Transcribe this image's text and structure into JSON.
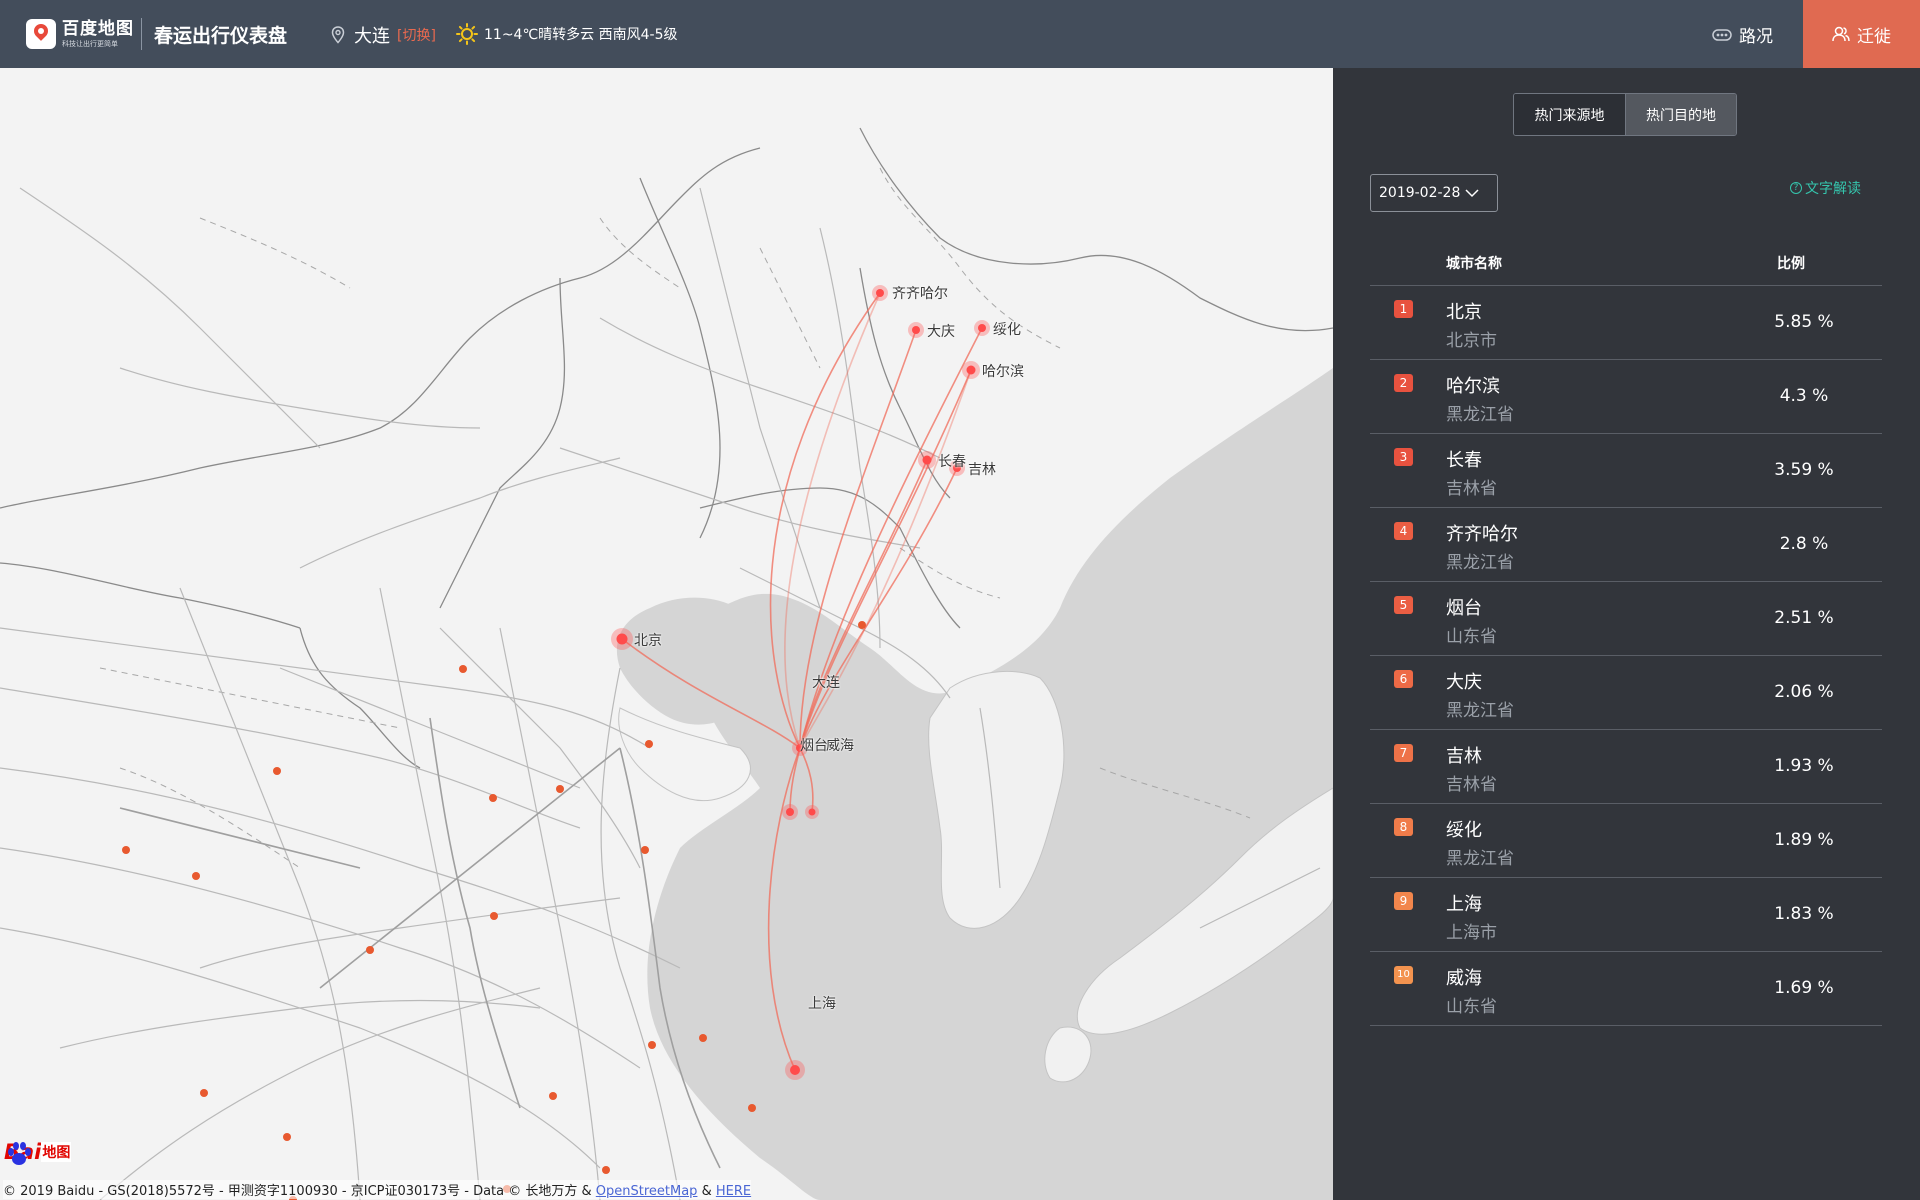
{
  "header": {
    "logo_name": "百度地图",
    "logo_sub": "科技让出行更简单",
    "title": "春运出行仪表盘",
    "city": "大连",
    "city_switch": "[切换]",
    "weather": "11~4℃晴转多云 西南风4-5级",
    "traffic_label": "路况",
    "migrate_label": "迁徙",
    "icons": [
      "pin-icon",
      "sun-icon",
      "traffic-icon",
      "user-icon"
    ],
    "accent_color": "#e06a51"
  },
  "map": {
    "origin": "大连",
    "cities": [
      {
        "name": "齐齐哈尔"
      },
      {
        "name": "大庆"
      },
      {
        "name": "绥化"
      },
      {
        "name": "哈尔滨"
      },
      {
        "name": "长春"
      },
      {
        "name": "吉林"
      },
      {
        "name": "北京"
      },
      {
        "name": "大连"
      },
      {
        "name": "烟台"
      },
      {
        "name": "威海"
      },
      {
        "name": "上海"
      }
    ],
    "flow_color": "#f06b5a",
    "baidu_bai": "Bai",
    "baidu_map": "地图",
    "copyright_text": "© 2019 Baidu - GS(2018)5572号 - 甲测资字1100930 - 京ICP证030173号 - Data © 长地万方 & ",
    "copyright_link1": "OpenStreetMap",
    "copyright_amp": " & ",
    "copyright_link2": "HERE"
  },
  "panel": {
    "tabs": [
      "热门来源地",
      "热门目的地"
    ],
    "active_tab": "热门目的地",
    "date": "2019-02-28",
    "explain_link": "文字解读",
    "col_city": "城市名称",
    "col_ratio": "比例",
    "rows": [
      {
        "rank": "1",
        "city": "北京",
        "province": "北京市",
        "ratio": "5.85 %",
        "badge_color": "#e8523f"
      },
      {
        "rank": "2",
        "city": "哈尔滨",
        "province": "黑龙江省",
        "ratio": "4.3 %",
        "badge_color": "#e8523f"
      },
      {
        "rank": "3",
        "city": "长春",
        "province": "吉林省",
        "ratio": "3.59 %",
        "badge_color": "#e8523f"
      },
      {
        "rank": "4",
        "city": "齐齐哈尔",
        "province": "黑龙江省",
        "ratio": "2.8 %",
        "badge_color": "#eb5e43"
      },
      {
        "rank": "5",
        "city": "烟台",
        "province": "山东省",
        "ratio": "2.51 %",
        "badge_color": "#eb5e43"
      },
      {
        "rank": "6",
        "city": "大庆",
        "province": "黑龙江省",
        "ratio": "2.06 %",
        "badge_color": "#ed6a46"
      },
      {
        "rank": "7",
        "city": "吉林",
        "province": "吉林省",
        "ratio": "1.93 %",
        "badge_color": "#ee7248"
      },
      {
        "rank": "8",
        "city": "绥化",
        "province": "黑龙江省",
        "ratio": "1.89 %",
        "badge_color": "#f07c4a"
      },
      {
        "rank": "9",
        "city": "上海",
        "province": "上海市",
        "ratio": "1.83 %",
        "badge_color": "#f2864c"
      },
      {
        "rank": "10",
        "city": "威海",
        "province": "山东省",
        "ratio": "1.69 %",
        "badge_color": "#f3934f"
      }
    ]
  }
}
